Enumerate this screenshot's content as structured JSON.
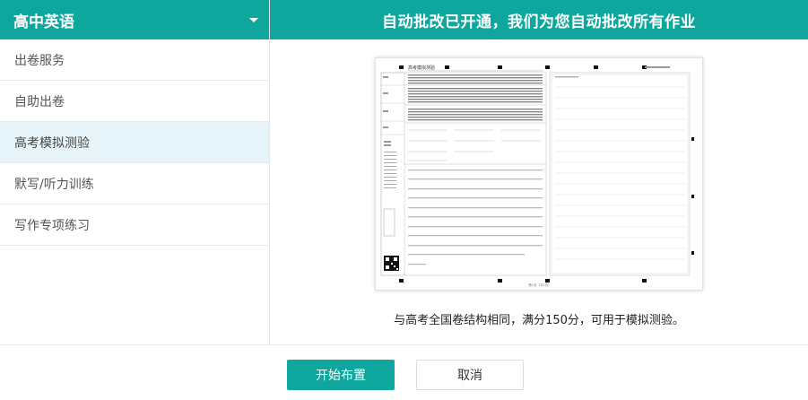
{
  "header": {
    "subject": "高中英语",
    "banner": "自动批改已开通，我们为您自动批改所有作业"
  },
  "sidebar": {
    "items": [
      {
        "label": "出卷服务"
      },
      {
        "label": "自助出卷"
      },
      {
        "label": "高考模拟测验",
        "active": true
      },
      {
        "label": "默写/听力训练"
      },
      {
        "label": "写作专项练习"
      }
    ]
  },
  "preview": {
    "paper_title": "高考模拟测验",
    "page_footer": "第1页（共1页）"
  },
  "caption": "与高考全国卷结构相同，满分150分，可用于模拟测验。",
  "footer": {
    "start_label": "开始布置",
    "cancel_label": "取消"
  },
  "colors": {
    "brand": "#0fa79d",
    "active_bg": "#e6f4f9"
  }
}
